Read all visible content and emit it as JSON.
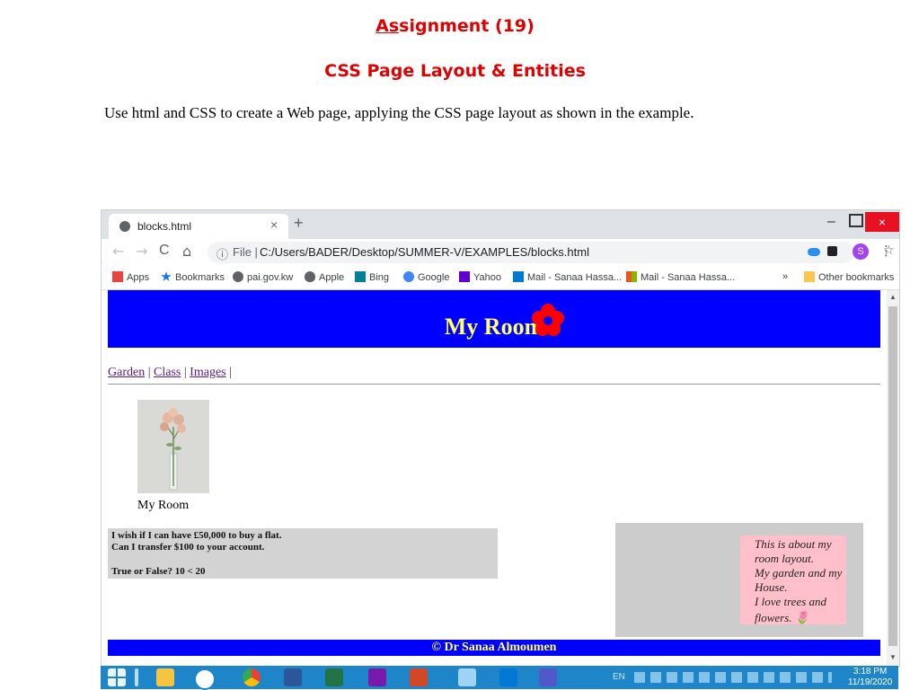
{
  "document": {
    "title_underlined": "As",
    "title_rest": "signment (19)",
    "subtitle": "CSS Page Layout & Entities",
    "instruction": "Use html and CSS to create a Web page, applying the CSS page layout as shown in the example."
  },
  "browser": {
    "tab_title": "blocks.html",
    "tab_close": "×",
    "new_tab": "+",
    "window_min": "–",
    "window_close": "×",
    "nav_back": "←",
    "nav_forward": "→",
    "nav_reload": "C",
    "nav_home": "⌂",
    "address_info": "ⓘ",
    "address_scheme": "File |",
    "address_url": "C:/Users/BADER/Desktop/SUMMER-V/EXAMPLES/blocks.html",
    "bookmark_star": "☆",
    "profile_initial": "S",
    "menu": "⋮",
    "bookmarks": [
      {
        "label": "Apps",
        "icon": "apps-grid-icon",
        "color": "#e8453c"
      },
      {
        "label": "Bookmarks",
        "icon": "star-icon",
        "color": "#1a73e8"
      },
      {
        "label": "pai.gov.kw",
        "icon": "globe-icon",
        "color": "#5f6368"
      },
      {
        "label": "Apple",
        "icon": "apple-icon",
        "color": "#5f6368"
      },
      {
        "label": "Bing",
        "icon": "bing-icon",
        "color": "#00809d"
      },
      {
        "label": "Google",
        "icon": "google-icon",
        "color": "#4285f4"
      },
      {
        "label": "Yahoo",
        "icon": "yahoo-icon",
        "color": "#6001d2"
      },
      {
        "label": "Mail - Sanaa Hassa...",
        "icon": "outlook-icon",
        "color": "#0078d4"
      },
      {
        "label": "Mail - Sanaa Hassa...",
        "icon": "microsoft-icon",
        "color": "#f25022"
      }
    ],
    "bookmarks_overflow": "»",
    "other_bookmarks": "Other bookmarks"
  },
  "page": {
    "header_title": "My Room",
    "nav_links": [
      "Garden",
      "Class",
      "Images"
    ],
    "nav_sep": "|",
    "photo_caption": "My Room",
    "left_lines": [
      "I wish if I can have £50,000 to buy a flat.",
      "Can I transfer $100 to your account.",
      "True or False? 10 < 20"
    ],
    "aside_lines": [
      "This is about my",
      "room layout.",
      "My garden and my",
      "House.",
      "I love trees and",
      "flowers. 🌷"
    ],
    "footer": "© Dr Sanaa Almoumen"
  },
  "colors": {
    "accent_red": "#e00000",
    "header_blue": "#0000ff",
    "header_text": "#ffff66",
    "aside_pink": "#ffc0cb",
    "box_gray": "#d3d3d3",
    "flower_red": "#ff0000"
  },
  "taskbar": {
    "time": "3:18 PM",
    "date": "11/19/2020",
    "lang": "EN",
    "apps": [
      "windows-start-icon",
      "task-view-icon",
      "file-explorer-icon",
      "hp-icon",
      "chrome-icon",
      "word-icon",
      "excel-icon",
      "onenote-icon",
      "powerpoint-icon",
      "notepad-icon",
      "outlook-icon",
      "teams-icon"
    ]
  }
}
